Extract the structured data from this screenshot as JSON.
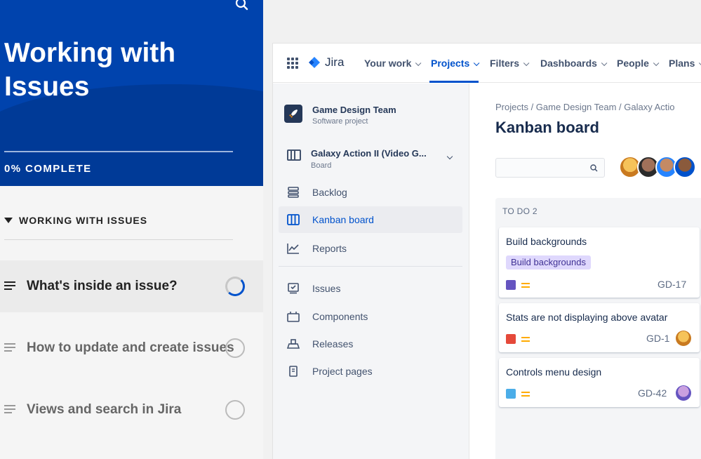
{
  "course": {
    "title": "Working with Issues",
    "progress": "0% COMPLETE",
    "section": "WORKING WITH ISSUES",
    "lessons": [
      {
        "title": "What's inside an issue?",
        "state": "in-progress"
      },
      {
        "title": "How to update and create issues",
        "state": "not-started"
      },
      {
        "title": "Views and search in Jira",
        "state": "not-started"
      }
    ]
  },
  "jira": {
    "logo": "Jira",
    "nav": [
      "Your work",
      "Projects",
      "Filters",
      "Dashboards",
      "People",
      "Plans"
    ],
    "active_nav": "Projects",
    "project": {
      "name": "Game Design Team",
      "type": "Software project"
    },
    "board": {
      "name": "Galaxy Action II (Video G...",
      "type": "Board"
    },
    "sidebar": [
      "Backlog",
      "Kanban board",
      "Reports",
      "Issues",
      "Components",
      "Releases",
      "Project pages"
    ],
    "active_sidebar": "Kanban board",
    "breadcrumb": "Projects  /  Game Design Team  /  Galaxy Actio",
    "page_title": "Kanban board",
    "column": {
      "title": "TO DO  2"
    },
    "cards": [
      {
        "title": "Build backgrounds",
        "epic": "Build backgrounds",
        "key": "GD-17",
        "type_color": "#6554c0"
      },
      {
        "title": "Stats are not displaying above avatar",
        "key": "GD-1",
        "type_color": "#e5493a"
      },
      {
        "title": "Controls menu design",
        "key": "GD-42",
        "type_color": "#4bade8"
      }
    ]
  },
  "colors": {
    "brand": "#0043ad",
    "jira_blue": "#0052cc"
  }
}
